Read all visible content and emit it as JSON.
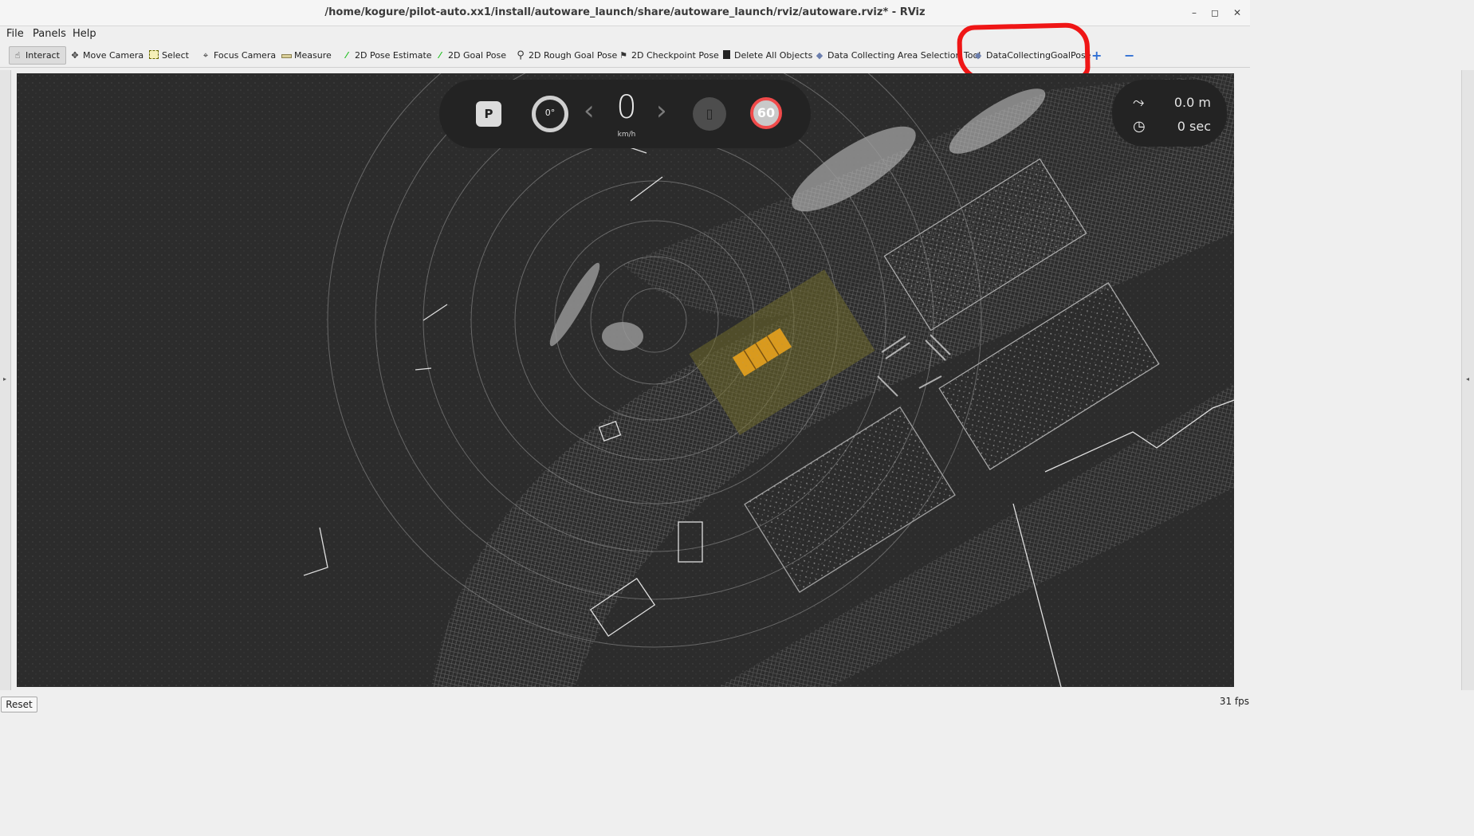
{
  "window": {
    "title": "/home/kogure/pilot-auto.xx1/install/autoware_launch/share/autoware_launch/rviz/autoware.rviz* - RViz",
    "minimize_label": "–",
    "maximize_label": "◻",
    "close_label": "✕"
  },
  "menu": [
    {
      "label": "File"
    },
    {
      "label": "Panels"
    },
    {
      "label": "Help"
    }
  ],
  "toolbar": {
    "tools": [
      {
        "label": "Interact",
        "icon": "hand-pointer-icon",
        "active": true
      },
      {
        "label": "Move Camera",
        "icon": "move-arrows-icon"
      },
      {
        "label": "Select",
        "icon": "dashed-select-icon"
      },
      {
        "label": "Focus Camera",
        "icon": "crosshair-icon"
      },
      {
        "label": "Measure",
        "icon": "ruler-icon"
      },
      {
        "label": "2D Pose Estimate",
        "icon": "green-arrow-icon"
      },
      {
        "label": "2D Goal Pose",
        "icon": "green-arrow-icon"
      },
      {
        "label": "2D Rough Goal Pose",
        "icon": "location-pin-icon"
      },
      {
        "label": "2D Checkpoint Pose",
        "icon": "flag-icon"
      },
      {
        "label": "Delete All Objects",
        "icon": "trash-icon"
      },
      {
        "label": "Data Collecting Area Selection Tool",
        "icon": "diamond-icon"
      },
      {
        "label": "DataCollectingGoalPose",
        "icon": "diamond-icon"
      }
    ],
    "add_tool_label": "+",
    "remove_tool_label": "−"
  },
  "hud": {
    "gear": "P",
    "steering": "0°",
    "speed": "0",
    "speed_unit": "km/h",
    "speed_limit": "60",
    "distance": "0.0 m",
    "time": "0 sec",
    "colors": {
      "limit_ring": "#f04a4a",
      "panel_bg": "#232323"
    }
  },
  "annotation": {
    "color": "#ef1616",
    "target": "DataCollectingGoalPose"
  },
  "status": {
    "reset_label": "Reset",
    "fps": "31 fps"
  }
}
